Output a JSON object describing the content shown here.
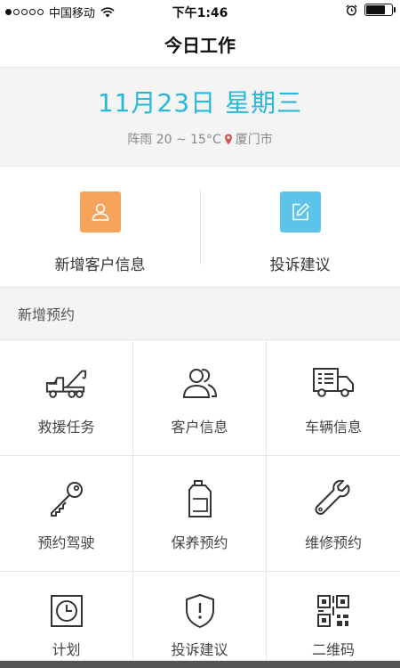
{
  "status_bar": {
    "carrier": "中国移动",
    "time": "下午1:46",
    "battery_level": 0.75
  },
  "nav": {
    "title": "今日工作"
  },
  "date_panel": {
    "date": "11月23日",
    "weekday": "星期三",
    "weather": "阵雨 20 ~ 15°C",
    "city": "厦门市",
    "accent_color": "#29b6d9"
  },
  "quick_actions": [
    {
      "label": "新增客户信息",
      "icon": "user-icon",
      "color": "#f6a35c"
    },
    {
      "label": "投诉建议",
      "icon": "edit-icon",
      "color": "#5cc3e9"
    }
  ],
  "section": {
    "title": "新增预约"
  },
  "grid": [
    {
      "label": "救援任务",
      "icon": "tow-truck-icon"
    },
    {
      "label": "客户信息",
      "icon": "users-icon"
    },
    {
      "label": "车辆信息",
      "icon": "truck-icon"
    },
    {
      "label": "预约驾驶",
      "icon": "key-icon"
    },
    {
      "label": "保养预约",
      "icon": "oil-can-icon"
    },
    {
      "label": "维修预约",
      "icon": "wrench-icon"
    },
    {
      "label": "计划",
      "icon": "clock-icon"
    },
    {
      "label": "投诉建议",
      "icon": "shield-alert-icon"
    },
    {
      "label": "二维码",
      "icon": "qr-code-icon"
    }
  ]
}
